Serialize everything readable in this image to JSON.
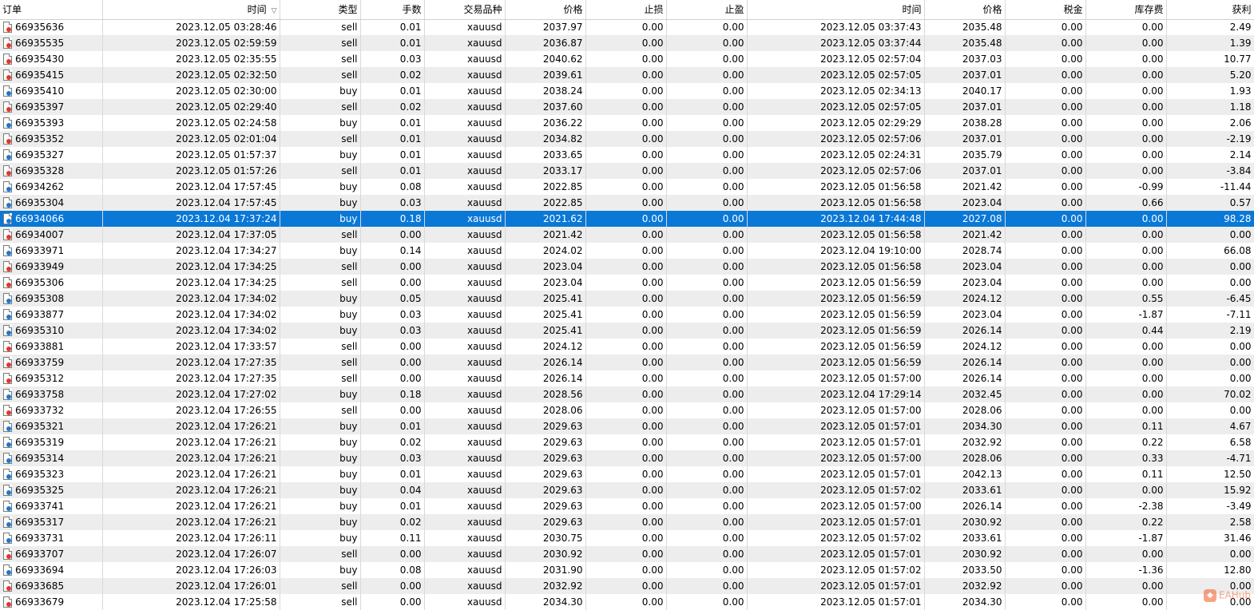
{
  "headers": [
    "订单",
    "时间",
    "类型",
    "手数",
    "交易品种",
    "价格",
    "止损",
    "止盈",
    "时间",
    "价格",
    "税金",
    "库存费",
    "获利"
  ],
  "sort_icon": "sort-down-icon",
  "watermark": "EAHub",
  "colors": {
    "selected_row": "#0a78d7",
    "sell_icon": "#e3372a",
    "buy_icon": "#1e78d0",
    "alt_row": "#ededed"
  },
  "selected_order": "66934066",
  "rows": [
    [
      "66935636",
      "2023.12.05 03:28:46",
      "sell",
      "0.01",
      "xauusd",
      "2037.97",
      "0.00",
      "0.00",
      "2023.12.05 03:37:43",
      "2035.48",
      "0.00",
      "0.00",
      "2.49"
    ],
    [
      "66935535",
      "2023.12.05 02:59:59",
      "sell",
      "0.01",
      "xauusd",
      "2036.87",
      "0.00",
      "0.00",
      "2023.12.05 03:37:44",
      "2035.48",
      "0.00",
      "0.00",
      "1.39"
    ],
    [
      "66935430",
      "2023.12.05 02:35:55",
      "sell",
      "0.03",
      "xauusd",
      "2040.62",
      "0.00",
      "0.00",
      "2023.12.05 02:57:04",
      "2037.03",
      "0.00",
      "0.00",
      "10.77"
    ],
    [
      "66935415",
      "2023.12.05 02:32:50",
      "sell",
      "0.02",
      "xauusd",
      "2039.61",
      "0.00",
      "0.00",
      "2023.12.05 02:57:05",
      "2037.01",
      "0.00",
      "0.00",
      "5.20"
    ],
    [
      "66935410",
      "2023.12.05 02:30:00",
      "buy",
      "0.01",
      "xauusd",
      "2038.24",
      "0.00",
      "0.00",
      "2023.12.05 02:34:13",
      "2040.17",
      "0.00",
      "0.00",
      "1.93"
    ],
    [
      "66935397",
      "2023.12.05 02:29:40",
      "sell",
      "0.02",
      "xauusd",
      "2037.60",
      "0.00",
      "0.00",
      "2023.12.05 02:57:05",
      "2037.01",
      "0.00",
      "0.00",
      "1.18"
    ],
    [
      "66935393",
      "2023.12.05 02:24:58",
      "buy",
      "0.01",
      "xauusd",
      "2036.22",
      "0.00",
      "0.00",
      "2023.12.05 02:29:29",
      "2038.28",
      "0.00",
      "0.00",
      "2.06"
    ],
    [
      "66935352",
      "2023.12.05 02:01:04",
      "sell",
      "0.01",
      "xauusd",
      "2034.82",
      "0.00",
      "0.00",
      "2023.12.05 02:57:06",
      "2037.01",
      "0.00",
      "0.00",
      "-2.19"
    ],
    [
      "66935327",
      "2023.12.05 01:57:37",
      "buy",
      "0.01",
      "xauusd",
      "2033.65",
      "0.00",
      "0.00",
      "2023.12.05 02:24:31",
      "2035.79",
      "0.00",
      "0.00",
      "2.14"
    ],
    [
      "66935328",
      "2023.12.05 01:57:26",
      "sell",
      "0.01",
      "xauusd",
      "2033.17",
      "0.00",
      "0.00",
      "2023.12.05 02:57:06",
      "2037.01",
      "0.00",
      "0.00",
      "-3.84"
    ],
    [
      "66934262",
      "2023.12.04 17:57:45",
      "buy",
      "0.08",
      "xauusd",
      "2022.85",
      "0.00",
      "0.00",
      "2023.12.05 01:56:58",
      "2021.42",
      "0.00",
      "-0.99",
      "-11.44"
    ],
    [
      "66935304",
      "2023.12.04 17:57:45",
      "buy",
      "0.03",
      "xauusd",
      "2022.85",
      "0.00",
      "0.00",
      "2023.12.05 01:56:58",
      "2023.04",
      "0.00",
      "0.66",
      "0.57"
    ],
    [
      "66934066",
      "2023.12.04 17:37:24",
      "buy",
      "0.18",
      "xauusd",
      "2021.62",
      "0.00",
      "0.00",
      "2023.12.04 17:44:48",
      "2027.08",
      "0.00",
      "0.00",
      "98.28"
    ],
    [
      "66934007",
      "2023.12.04 17:37:05",
      "sell",
      "0.00",
      "xauusd",
      "2021.42",
      "0.00",
      "0.00",
      "2023.12.05 01:56:58",
      "2021.42",
      "0.00",
      "0.00",
      "0.00"
    ],
    [
      "66933971",
      "2023.12.04 17:34:27",
      "buy",
      "0.14",
      "xauusd",
      "2024.02",
      "0.00",
      "0.00",
      "2023.12.04 19:10:00",
      "2028.74",
      "0.00",
      "0.00",
      "66.08"
    ],
    [
      "66933949",
      "2023.12.04 17:34:25",
      "sell",
      "0.00",
      "xauusd",
      "2023.04",
      "0.00",
      "0.00",
      "2023.12.05 01:56:58",
      "2023.04",
      "0.00",
      "0.00",
      "0.00"
    ],
    [
      "66935306",
      "2023.12.04 17:34:25",
      "sell",
      "0.00",
      "xauusd",
      "2023.04",
      "0.00",
      "0.00",
      "2023.12.05 01:56:59",
      "2023.04",
      "0.00",
      "0.00",
      "0.00"
    ],
    [
      "66935308",
      "2023.12.04 17:34:02",
      "buy",
      "0.05",
      "xauusd",
      "2025.41",
      "0.00",
      "0.00",
      "2023.12.05 01:56:59",
      "2024.12",
      "0.00",
      "0.55",
      "-6.45"
    ],
    [
      "66933877",
      "2023.12.04 17:34:02",
      "buy",
      "0.03",
      "xauusd",
      "2025.41",
      "0.00",
      "0.00",
      "2023.12.05 01:56:59",
      "2023.04",
      "0.00",
      "-1.87",
      "-7.11"
    ],
    [
      "66935310",
      "2023.12.04 17:34:02",
      "buy",
      "0.03",
      "xauusd",
      "2025.41",
      "0.00",
      "0.00",
      "2023.12.05 01:56:59",
      "2026.14",
      "0.00",
      "0.44",
      "2.19"
    ],
    [
      "66933881",
      "2023.12.04 17:33:57",
      "sell",
      "0.00",
      "xauusd",
      "2024.12",
      "0.00",
      "0.00",
      "2023.12.05 01:56:59",
      "2024.12",
      "0.00",
      "0.00",
      "0.00"
    ],
    [
      "66933759",
      "2023.12.04 17:27:35",
      "sell",
      "0.00",
      "xauusd",
      "2026.14",
      "0.00",
      "0.00",
      "2023.12.05 01:56:59",
      "2026.14",
      "0.00",
      "0.00",
      "0.00"
    ],
    [
      "66935312",
      "2023.12.04 17:27:35",
      "sell",
      "0.00",
      "xauusd",
      "2026.14",
      "0.00",
      "0.00",
      "2023.12.05 01:57:00",
      "2026.14",
      "0.00",
      "0.00",
      "0.00"
    ],
    [
      "66933758",
      "2023.12.04 17:27:02",
      "buy",
      "0.18",
      "xauusd",
      "2028.56",
      "0.00",
      "0.00",
      "2023.12.04 17:29:14",
      "2032.45",
      "0.00",
      "0.00",
      "70.02"
    ],
    [
      "66933732",
      "2023.12.04 17:26:55",
      "sell",
      "0.00",
      "xauusd",
      "2028.06",
      "0.00",
      "0.00",
      "2023.12.05 01:57:00",
      "2028.06",
      "0.00",
      "0.00",
      "0.00"
    ],
    [
      "66935321",
      "2023.12.04 17:26:21",
      "buy",
      "0.01",
      "xauusd",
      "2029.63",
      "0.00",
      "0.00",
      "2023.12.05 01:57:01",
      "2034.30",
      "0.00",
      "0.11",
      "4.67"
    ],
    [
      "66935319",
      "2023.12.04 17:26:21",
      "buy",
      "0.02",
      "xauusd",
      "2029.63",
      "0.00",
      "0.00",
      "2023.12.05 01:57:01",
      "2032.92",
      "0.00",
      "0.22",
      "6.58"
    ],
    [
      "66935314",
      "2023.12.04 17:26:21",
      "buy",
      "0.03",
      "xauusd",
      "2029.63",
      "0.00",
      "0.00",
      "2023.12.05 01:57:00",
      "2028.06",
      "0.00",
      "0.33",
      "-4.71"
    ],
    [
      "66935323",
      "2023.12.04 17:26:21",
      "buy",
      "0.01",
      "xauusd",
      "2029.63",
      "0.00",
      "0.00",
      "2023.12.05 01:57:01",
      "2042.13",
      "0.00",
      "0.11",
      "12.50"
    ],
    [
      "66935325",
      "2023.12.04 17:26:21",
      "buy",
      "0.04",
      "xauusd",
      "2029.63",
      "0.00",
      "0.00",
      "2023.12.05 01:57:02",
      "2033.61",
      "0.00",
      "0.00",
      "15.92"
    ],
    [
      "66933741",
      "2023.12.04 17:26:21",
      "buy",
      "0.01",
      "xauusd",
      "2029.63",
      "0.00",
      "0.00",
      "2023.12.05 01:57:00",
      "2026.14",
      "0.00",
      "-2.38",
      "-3.49"
    ],
    [
      "66935317",
      "2023.12.04 17:26:21",
      "buy",
      "0.02",
      "xauusd",
      "2029.63",
      "0.00",
      "0.00",
      "2023.12.05 01:57:01",
      "2030.92",
      "0.00",
      "0.22",
      "2.58"
    ],
    [
      "66933731",
      "2023.12.04 17:26:11",
      "buy",
      "0.11",
      "xauusd",
      "2030.75",
      "0.00",
      "0.00",
      "2023.12.05 01:57:02",
      "2033.61",
      "0.00",
      "-1.87",
      "31.46"
    ],
    [
      "66933707",
      "2023.12.04 17:26:07",
      "sell",
      "0.00",
      "xauusd",
      "2030.92",
      "0.00",
      "0.00",
      "2023.12.05 01:57:01",
      "2030.92",
      "0.00",
      "0.00",
      "0.00"
    ],
    [
      "66933694",
      "2023.12.04 17:26:03",
      "buy",
      "0.08",
      "xauusd",
      "2031.90",
      "0.00",
      "0.00",
      "2023.12.05 01:57:02",
      "2033.50",
      "0.00",
      "-1.36",
      "12.80"
    ],
    [
      "66933685",
      "2023.12.04 17:26:01",
      "sell",
      "0.00",
      "xauusd",
      "2032.92",
      "0.00",
      "0.00",
      "2023.12.05 01:57:01",
      "2032.92",
      "0.00",
      "0.00",
      "0.00"
    ],
    [
      "66933679",
      "2023.12.04 17:25:58",
      "sell",
      "0.00",
      "xauusd",
      "2034.30",
      "0.00",
      "0.00",
      "2023.12.05 01:57:01",
      "2034.30",
      "0.00",
      "0.00",
      "0.00"
    ]
  ]
}
